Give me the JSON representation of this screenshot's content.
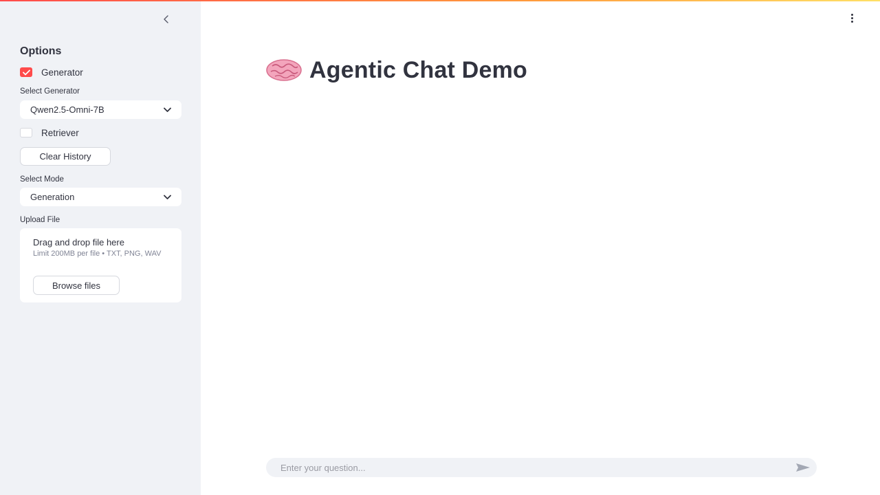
{
  "sidebar": {
    "collapse_icon": "chevron-left-icon",
    "title": "Options",
    "generator_checkbox": {
      "label": "Generator",
      "checked": true
    },
    "select_generator": {
      "label": "Select Generator",
      "value": "Qwen2.5-Omni-7B"
    },
    "retriever_checkbox": {
      "label": "Retriever",
      "checked": false
    },
    "clear_history_label": "Clear History",
    "select_mode": {
      "label": "Select Mode",
      "value": "Generation"
    },
    "upload": {
      "label": "Upload File",
      "drop_text": "Drag and drop file here",
      "limit_text": "Limit 200MB per file • TXT, PNG, WAV",
      "browse_label": "Browse files"
    }
  },
  "main": {
    "menu_icon": "more-vertical-icon",
    "title_icon": "brain-emoji-icon",
    "title": "Agentic Chat Demo",
    "chat_input": {
      "placeholder": "Enter your question...",
      "value": ""
    },
    "send_icon": "send-icon"
  },
  "colors": {
    "accent": "#ff4b4b",
    "sidebar_bg": "#f0f2f6",
    "text": "#31333f"
  }
}
